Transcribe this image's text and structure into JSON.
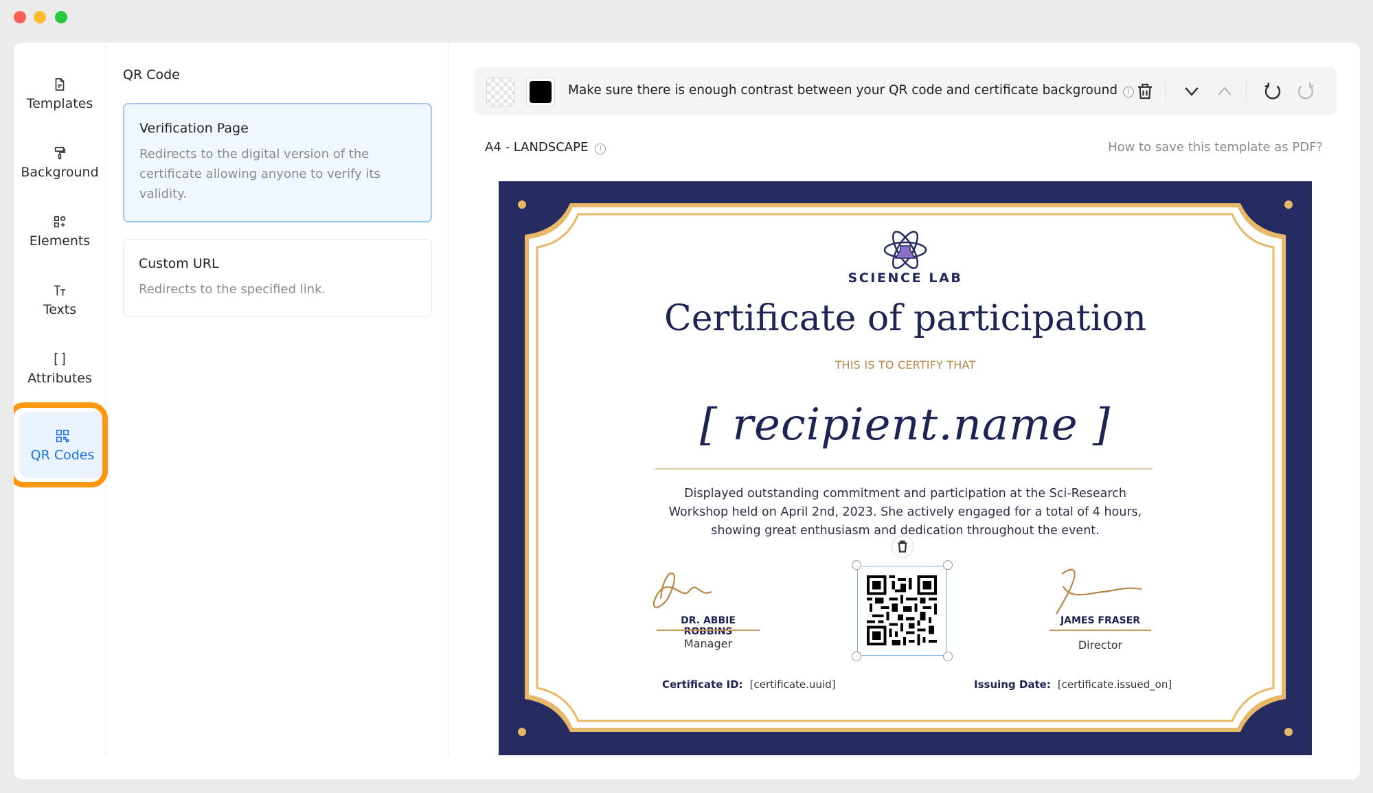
{
  "sidebar": {
    "items": [
      {
        "label": "Templates",
        "icon": "file-icon"
      },
      {
        "label": "Background",
        "icon": "paint-roller-icon"
      },
      {
        "label": "Elements",
        "icon": "shapes-icon"
      },
      {
        "label": "Texts",
        "icon": "text-icon"
      },
      {
        "label": "Attributes",
        "icon": "brackets-icon"
      },
      {
        "label": "QR Codes",
        "icon": "qr-code-icon",
        "active": true
      }
    ],
    "highlight_color": "#ff9811",
    "active_color": "#1a73e8"
  },
  "panel": {
    "title": "QR Code",
    "options": [
      {
        "title": "Verification Page",
        "description": "Redirects to the digital version of the certificate allowing anyone to verify its validity.",
        "selected": true
      },
      {
        "title": "Custom URL",
        "description": "Redirects to the specified link.",
        "selected": false
      }
    ]
  },
  "toolbar": {
    "message": "Make sure there is enough contrast between your QR code and certificate background",
    "info_icon": "info-icon",
    "colors": [
      "transparent",
      "#000000"
    ]
  },
  "canvas": {
    "size_label": "A4 - LANDSCAPE",
    "help_link": "How to save this template as PDF?"
  },
  "certificate": {
    "org_name": "SCIENCE LAB",
    "title": "Certificate of participation",
    "certify_text": "THIS IS TO CERTIFY THAT",
    "recipient_placeholder": "[ recipient.name ]",
    "body": "Displayed outstanding commitment and participation at the Sci-Research Workshop held on April 2nd, 2023. She actively engaged for a total of 4 hours, showing great enthusiasm and dedication throughout the event.",
    "signatories": [
      {
        "name": "DR. ABBIE ROBBINS",
        "role": "Manager"
      },
      {
        "name": "JAMES FRASER",
        "role": "Director"
      }
    ],
    "certificate_id_label": "Certificate ID:",
    "certificate_id_value": "[certificate.uuid]",
    "issuing_date_label": "Issuing Date:",
    "issuing_date_value": "[certificate.issued_on]",
    "colors": {
      "navy": "#262c5f",
      "gold": "#e7b86a",
      "accent_text": "#b98546"
    }
  }
}
